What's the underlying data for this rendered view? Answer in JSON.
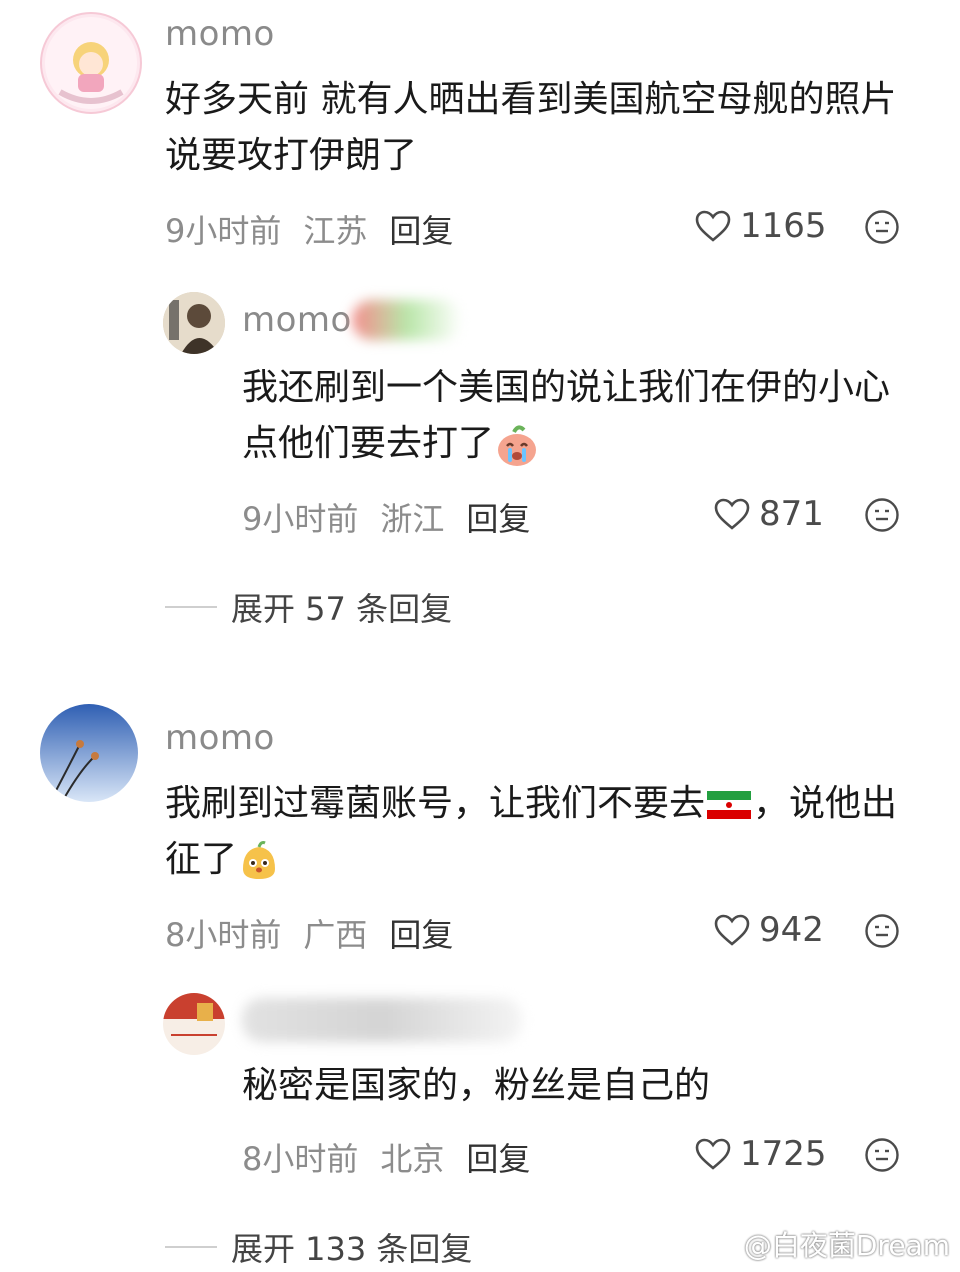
{
  "comments": [
    {
      "user": "momo",
      "text_line1": "好多天前 就有人晒出看到美国航空母舰的照片",
      "text_line2": "说要攻打伊朗了",
      "time": "9小时前",
      "location": "江苏",
      "reply_label": "回复",
      "likes": "1165",
      "reply": {
        "user": "momo",
        "text_line1": "我还刷到一个美国的说让我们在伊的小心",
        "text_line2": "点他们要去打了",
        "time": "9小时前",
        "location": "浙江",
        "reply_label": "回复",
        "likes": "871"
      },
      "expand_label": "展开 57 条回复"
    },
    {
      "user": "momo",
      "text_line1_a": "我刷到过霉菌账号，让我们不要去",
      "text_line1_b": "，说他出",
      "text_line2": "征了",
      "time": "8小时前",
      "location": "广西",
      "reply_label": "回复",
      "likes": "942",
      "reply": {
        "text_line1": "秘密是国家的，粉丝是自己的",
        "time": "8小时前",
        "location": "北京",
        "reply_label": "回复",
        "likes": "1725"
      },
      "expand_label": "展开 133 条回复"
    }
  ],
  "watermark": "@白夜菌Dream",
  "colors": {
    "meta": "#8c8c8c",
    "name": "#8a8a8a",
    "text": "#1a1a1a"
  }
}
